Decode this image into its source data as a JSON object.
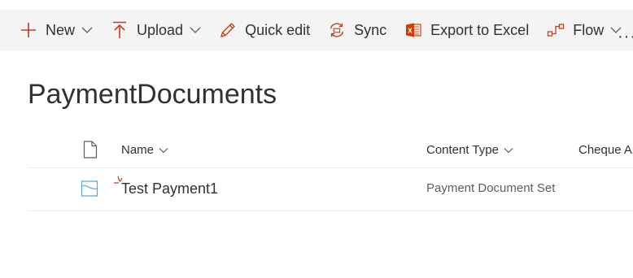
{
  "toolbar": {
    "new_label": "New",
    "upload_label": "Upload",
    "quick_edit_label": "Quick edit",
    "sync_label": "Sync",
    "export_label": "Export to Excel",
    "flow_label": "Flow",
    "more_label": "···"
  },
  "page": {
    "title": "PaymentDocuments"
  },
  "columns": {
    "name": "Name",
    "content_type": "Content Type",
    "cheque": "Cheque Ar"
  },
  "rows": [
    {
      "name": "Test Payment1",
      "content_type": "Payment Document Set"
    }
  ],
  "colors": {
    "accent": "#c43e1c",
    "excel": "#d83b01",
    "toolbar_bg": "#f4f4f4",
    "text": "#323130",
    "doc_icon": "#5ea3d9"
  },
  "icons": {
    "new": "plus-icon",
    "upload": "upload-icon",
    "quick_edit": "pencil-icon",
    "sync": "sync-icon",
    "export": "excel-icon",
    "flow": "flow-icon",
    "file_type_header": "document-icon",
    "row_type": "document-set-icon",
    "new_item": "new-item-indicator-icon"
  }
}
